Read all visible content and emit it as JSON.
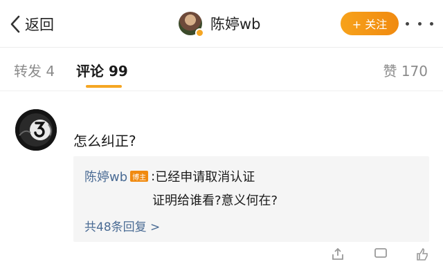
{
  "nav": {
    "back_label": "返回",
    "title": "陈婷wb",
    "follow_label": "+ 关注"
  },
  "tabs": {
    "repost": "转发 4",
    "comments": "评论 99",
    "likes": "赞 170"
  },
  "comment": {
    "text": "怎么纠正?",
    "reply": {
      "user": "陈婷wb",
      "badge": "博主",
      "colon": ":",
      "text_line1": "已经申请取消认证",
      "text_line2": "证明给谁看?意义何在?",
      "more": "共48条回复 >"
    }
  },
  "colors": {
    "accent": "#f5a623",
    "link": "#4a6b94"
  }
}
